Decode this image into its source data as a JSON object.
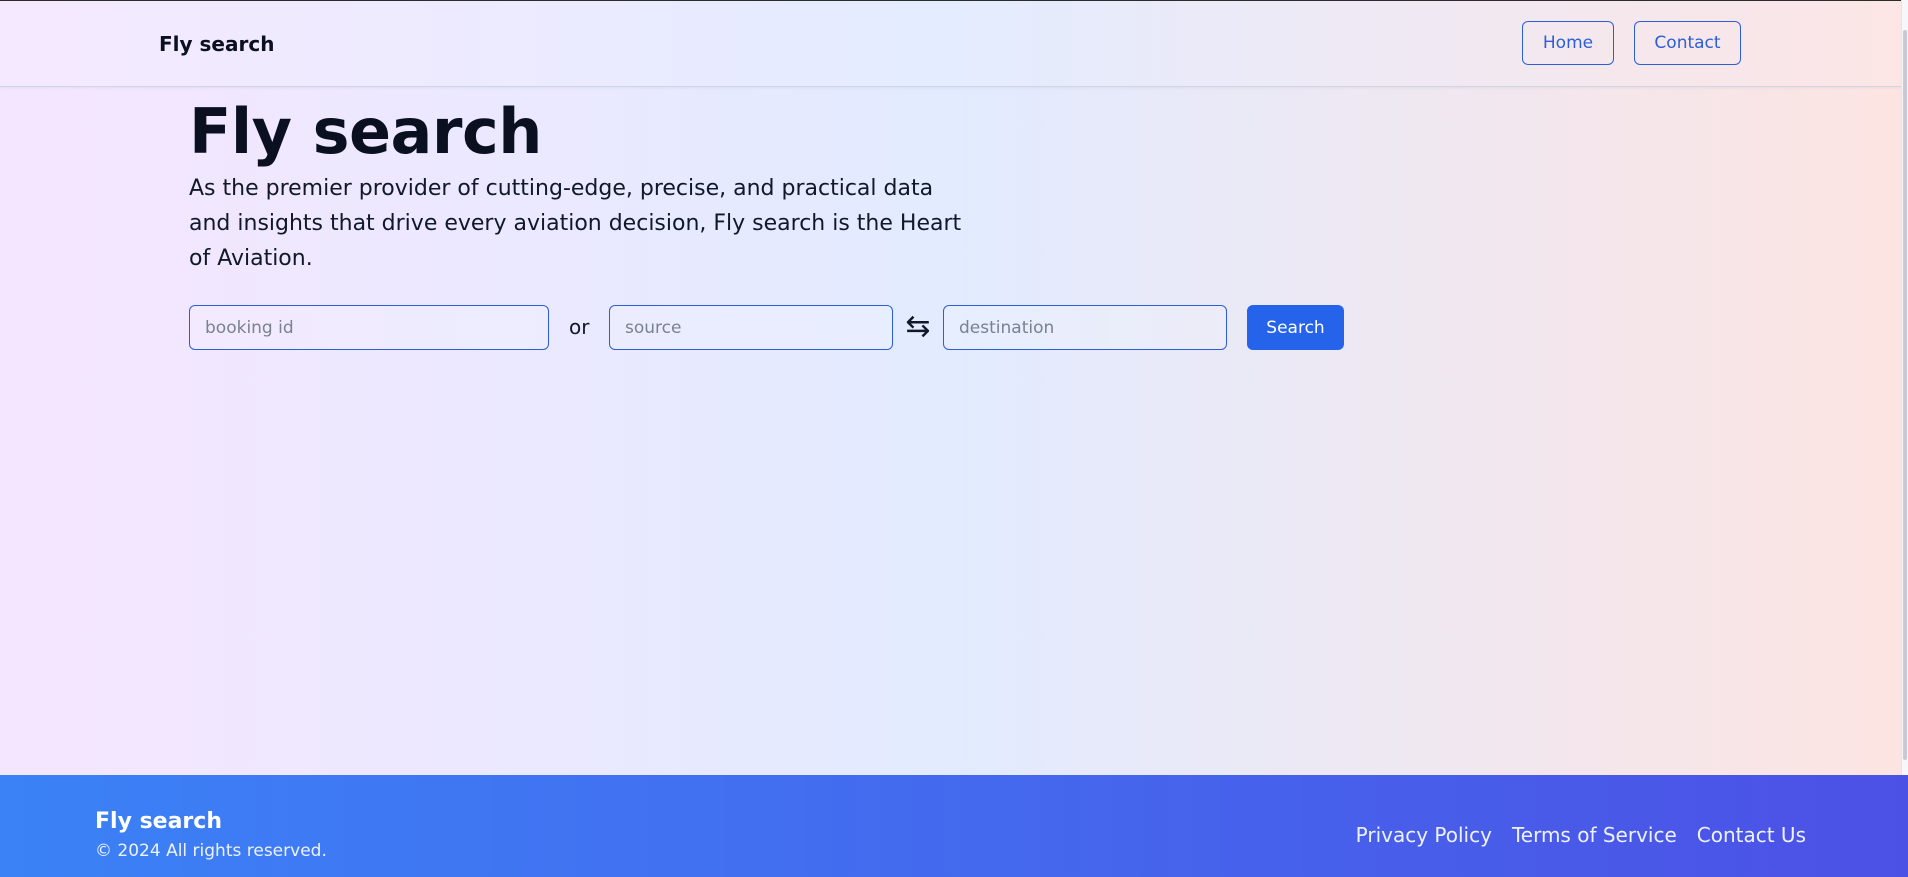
{
  "navbar": {
    "brand": "Fly search",
    "home_label": "Home",
    "contact_label": "Contact"
  },
  "hero": {
    "title": "Fly search",
    "description": "As the premier provider of cutting-edge, precise, and practical data and insights that drive every aviation decision, Fly search is the Heart of Aviation."
  },
  "search": {
    "booking_placeholder": "booking id",
    "booking_value": "",
    "or_label": "or",
    "source_placeholder": "source",
    "source_value": "",
    "swap_icon": "⇆",
    "destination_placeholder": "destination",
    "destination_value": "",
    "button_label": "Search"
  },
  "footer": {
    "brand": "Fly search",
    "copyright": "© 2024 All rights reserved.",
    "links": [
      {
        "label": "Privacy Policy"
      },
      {
        "label": "Terms of Service"
      },
      {
        "label": "Contact Us"
      }
    ]
  },
  "colors": {
    "accent": "#2563eb",
    "nav_border": "#2c5fd6",
    "footer_start": "#3b82f6",
    "footer_end": "#4c51e6"
  }
}
